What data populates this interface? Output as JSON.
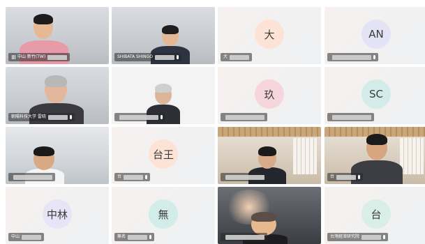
{
  "tiles": [
    {
      "id": "t1",
      "kind": "video",
      "scene": "office",
      "label": "中山  新竹(TW)",
      "mic": false
    },
    {
      "id": "t2",
      "kind": "video",
      "scene": "office",
      "label": "SHIBATA SHINGO",
      "mic": true
    },
    {
      "id": "t3",
      "kind": "avatar",
      "initials": "大",
      "color": "#fde2d6",
      "label": "大",
      "mic": false
    },
    {
      "id": "t4",
      "kind": "avatar",
      "initials": "AN",
      "color": "#e4e3f5",
      "label": "",
      "mic": true
    },
    {
      "id": "t5",
      "kind": "video",
      "scene": "office",
      "label": "朝陽科技大学  雷晓",
      "mic": true
    },
    {
      "id": "t6",
      "kind": "video",
      "scene": "white",
      "label": "",
      "mic": true
    },
    {
      "id": "t7",
      "kind": "avatar",
      "initials": "玖",
      "color": "#f6d6dc",
      "label": "",
      "mic": false
    },
    {
      "id": "t8",
      "kind": "avatar",
      "initials": "SC",
      "color": "#d3ebe9",
      "label": "",
      "mic": false
    },
    {
      "id": "t9",
      "kind": "video",
      "scene": "class",
      "label": "",
      "mic": false
    },
    {
      "id": "t10",
      "kind": "avatar",
      "initials": "台王",
      "color": "#fde3d6",
      "label": "台",
      "mic": true
    },
    {
      "id": "t11",
      "kind": "video",
      "scene": "room",
      "label": "",
      "mic": false
    },
    {
      "id": "t12",
      "kind": "video",
      "scene": "room",
      "label": "台",
      "mic": true
    },
    {
      "id": "t13",
      "kind": "avatar",
      "initials": "中林",
      "color": "#e6e4f6",
      "label": "中山",
      "mic": false
    },
    {
      "id": "t14",
      "kind": "avatar",
      "initials": "無",
      "color": "#d2ece8",
      "label": "無名",
      "mic": true
    },
    {
      "id": "t15",
      "kind": "video",
      "scene": "dark",
      "label": "",
      "mic": false
    },
    {
      "id": "t16",
      "kind": "avatar",
      "initials": "台",
      "color": "#d8eee7",
      "label": "台灣經濟研究院",
      "mic": true
    }
  ]
}
